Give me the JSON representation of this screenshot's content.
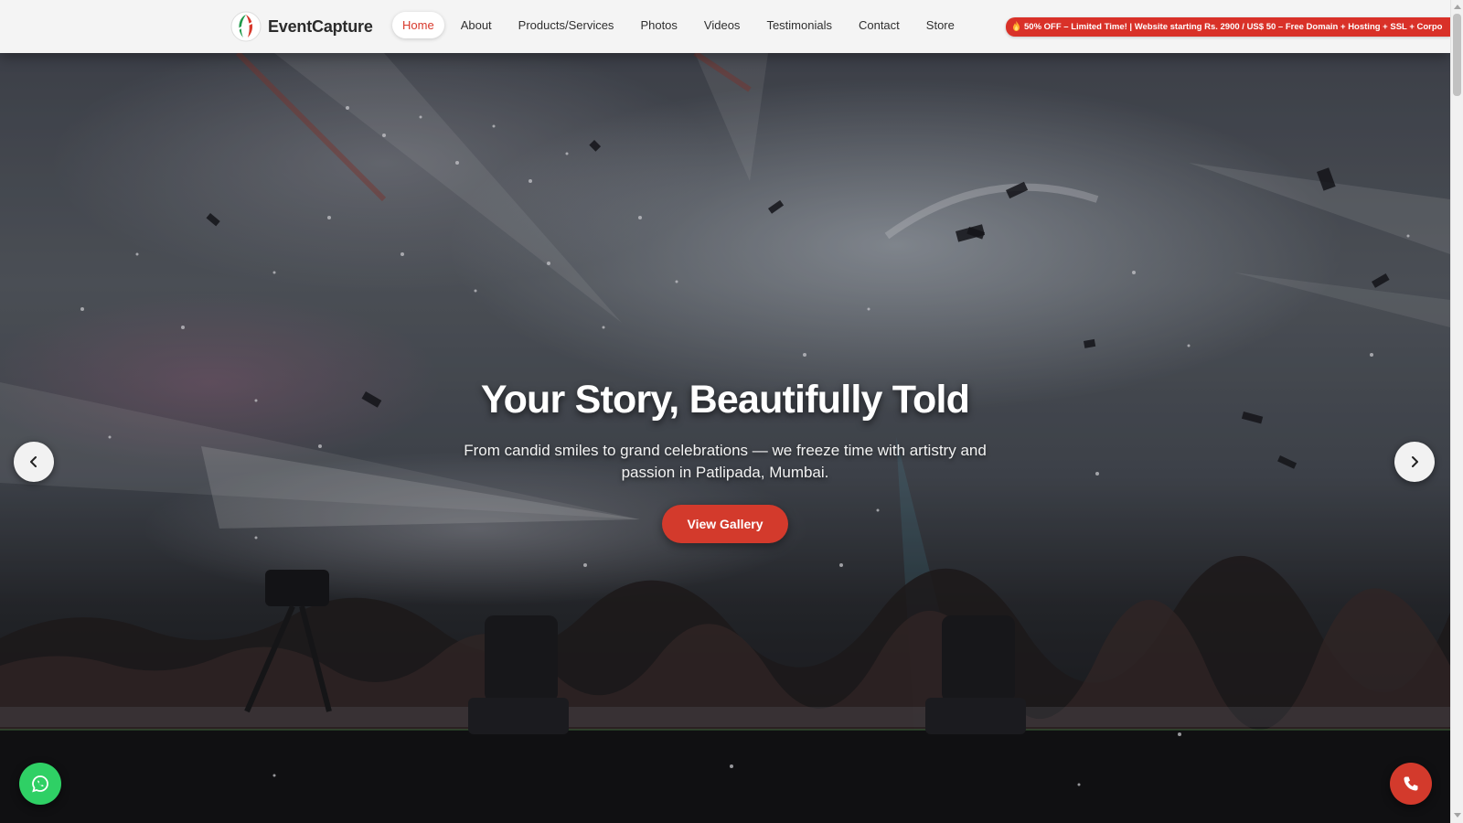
{
  "brand": {
    "name": "EventCapture"
  },
  "nav": {
    "items": [
      {
        "label": "Home",
        "active": true
      },
      {
        "label": "About",
        "active": false
      },
      {
        "label": "Products/Services",
        "active": false
      },
      {
        "label": "Photos",
        "active": false
      },
      {
        "label": "Videos",
        "active": false
      },
      {
        "label": "Testimonials",
        "active": false
      },
      {
        "label": "Contact",
        "active": false
      },
      {
        "label": "Store",
        "active": false
      }
    ]
  },
  "promo": {
    "icon": "fire-icon",
    "text": "50% OFF – Limited Time! | Website starting Rs. 2900 / US$ 50 – Free Domain + Hosting + SSL + Corpo"
  },
  "hero": {
    "title": "Your Story, Beautifully Told",
    "subtitle": "From candid smiles to grand celebrations — we freeze time with artistry and passion in Patlipada, Mumbai.",
    "cta_label": "View Gallery"
  },
  "carousel": {
    "prev_icon": "chevron-left-icon",
    "next_icon": "chevron-right-icon"
  },
  "floating": {
    "whatsapp_icon": "whatsapp-icon",
    "call_icon": "phone-icon"
  },
  "colors": {
    "accent": "#d33a2c",
    "navbar_bg": "#f4f4f4",
    "whatsapp": "#2fd065",
    "logo_green": "#1f9a4b",
    "logo_red": "#d8392c"
  }
}
